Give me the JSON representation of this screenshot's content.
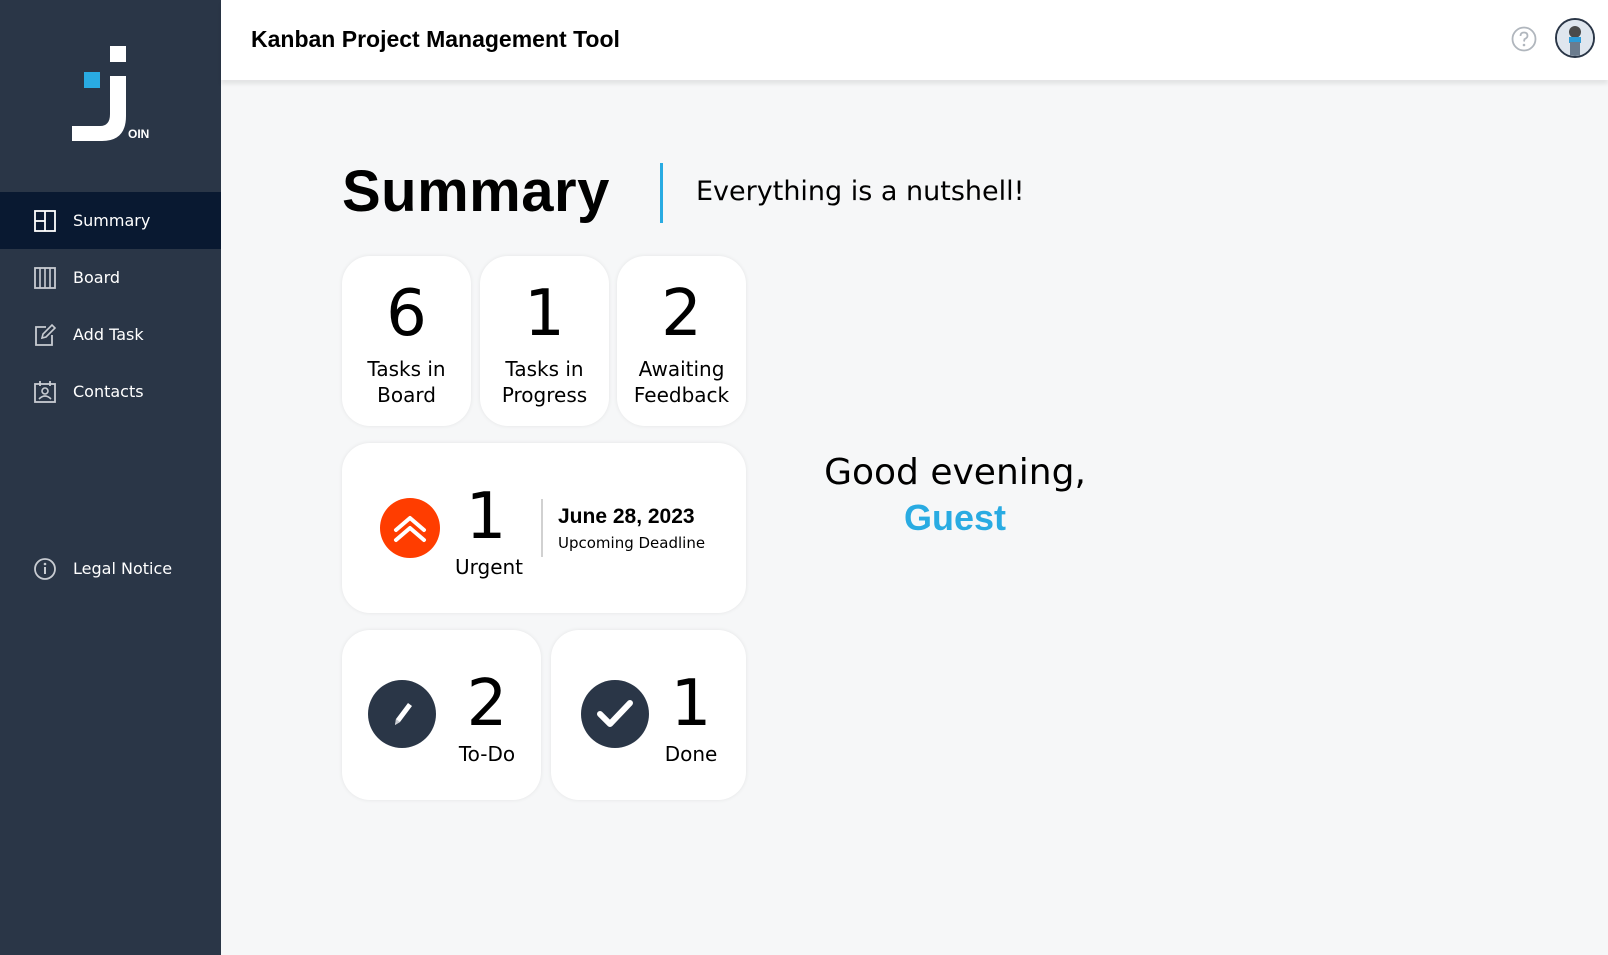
{
  "app": {
    "logo_text": "OIN",
    "header_title": "Kanban Project Management Tool"
  },
  "sidebar": {
    "items": [
      {
        "label": "Summary",
        "icon": "summary-icon",
        "active": true
      },
      {
        "label": "Board",
        "icon": "board-icon",
        "active": false
      },
      {
        "label": "Add Task",
        "icon": "add-task-icon",
        "active": false
      },
      {
        "label": "Contacts",
        "icon": "contacts-icon",
        "active": false
      }
    ],
    "legal": {
      "label": "Legal Notice",
      "icon": "info-icon"
    }
  },
  "summary": {
    "title": "Summary",
    "subtitle": "Everything is a nutshell!",
    "stats": [
      {
        "value": "6",
        "label_line1": "Tasks in",
        "label_line2": "Board"
      },
      {
        "value": "1",
        "label_line1": "Tasks in",
        "label_line2": "Progress"
      },
      {
        "value": "2",
        "label_line1": "Awaiting",
        "label_line2": "Feedback"
      }
    ],
    "urgent": {
      "value": "1",
      "label": "Urgent",
      "deadline_date": "June 28, 2023",
      "deadline_label": "Upcoming Deadline"
    },
    "todo": {
      "value": "2",
      "label": "To-Do"
    },
    "done": {
      "value": "1",
      "label": "Done"
    }
  },
  "greeting": {
    "line": "Good evening,",
    "name": "Guest"
  },
  "colors": {
    "sidebar_bg": "#2a3647",
    "sidebar_active": "#091931",
    "accent": "#29abe2",
    "urgent": "#ff3d00"
  }
}
